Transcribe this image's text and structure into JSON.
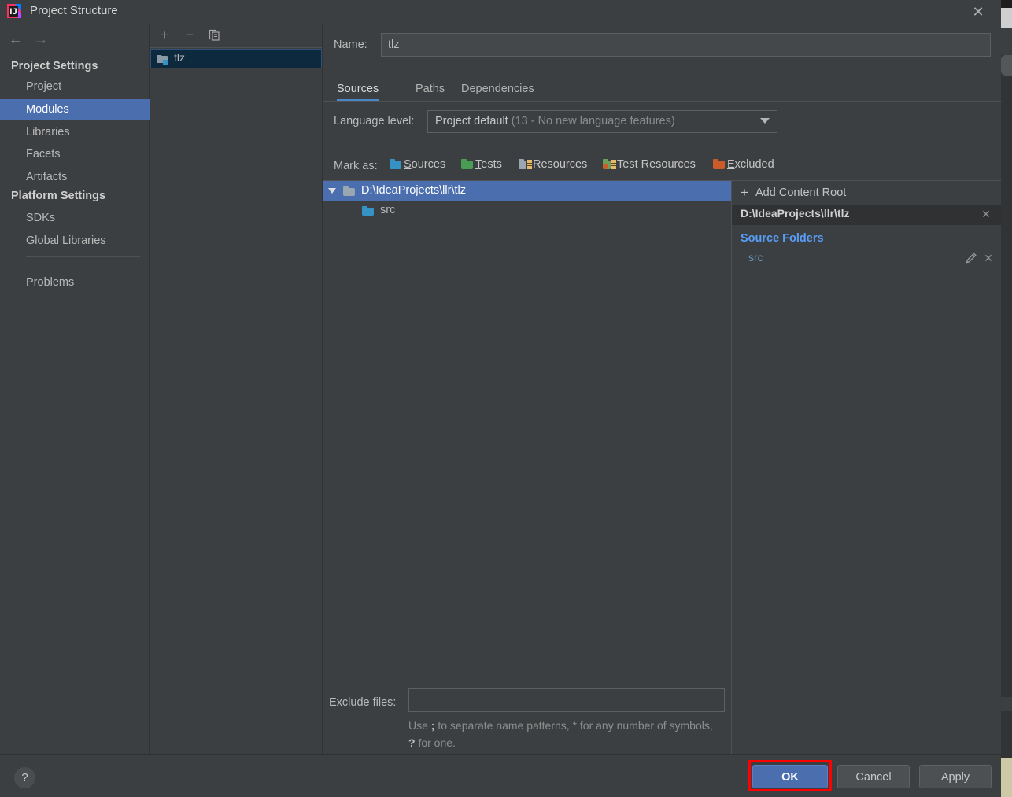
{
  "window": {
    "title": "Project Structure",
    "app_icon": "intellij-idea-logo",
    "close_icon": "✕"
  },
  "nav": {
    "back_icon": "←",
    "forward_icon": "→"
  },
  "sidebar": {
    "groups": [
      {
        "label": "Project Settings"
      },
      {
        "label": "Platform Settings"
      }
    ],
    "items": [
      {
        "label": "Project",
        "selected": false
      },
      {
        "label": "Modules",
        "selected": true
      },
      {
        "label": "Libraries",
        "selected": false
      },
      {
        "label": "Facets",
        "selected": false
      },
      {
        "label": "Artifacts",
        "selected": false
      },
      {
        "label": "SDKs",
        "selected": false
      },
      {
        "label": "Global Libraries",
        "selected": false
      },
      {
        "label": "Problems",
        "selected": false
      }
    ]
  },
  "modules_panel": {
    "toolbar": {
      "add_icon": "+",
      "remove_icon": "−",
      "copy_icon": "copy-icon"
    },
    "modules": [
      {
        "name": "tlz",
        "icon": "module-folder-icon",
        "selected": true
      }
    ]
  },
  "main": {
    "name_label": "Name:",
    "name_value": "tlz",
    "tabs": [
      {
        "label": "Sources",
        "active": true
      },
      {
        "label": "Paths",
        "active": false
      },
      {
        "label": "Dependencies",
        "active": false
      }
    ],
    "language_level": {
      "label": "Language level:",
      "value": "Project default",
      "value_suffix": " (13 - No new language features)",
      "arrow_icon": "chevron-down-icon"
    },
    "mark_as": {
      "label": "Mark as:",
      "options": [
        {
          "label": "Sources",
          "mnemonic": "S",
          "color": "#3592c4"
        },
        {
          "label": "Tests",
          "mnemonic": "T",
          "color": "#499c54"
        },
        {
          "label": "Resources",
          "mnemonic": "R",
          "color": "#9aa7b0"
        },
        {
          "label": "Test Resources",
          "mnemonic": "T",
          "color": "#6e9f5a"
        },
        {
          "label": "Excluded",
          "mnemonic": "E",
          "color": "#cc5b28"
        }
      ]
    },
    "content_tree": {
      "root": {
        "label": "D:\\IdeaProjects\\llr\\tlz",
        "icon": "folder-icon",
        "expanded": true,
        "selected": true
      },
      "children": [
        {
          "label": "src",
          "icon": "source-folder-icon",
          "color": "#3592c4"
        }
      ]
    },
    "root_panel": {
      "add_content_root": {
        "label": "Add Content Root",
        "mnemonic": "C",
        "plus_icon": "+"
      },
      "content_root_path": "D:\\IdeaProjects\\llr\\tlz",
      "content_root_close_icon": "✕",
      "source_folders_title": "Source Folders",
      "source_folders": [
        {
          "name": "src",
          "edit_icon": "pencil-icon",
          "remove_icon": "✕"
        }
      ]
    },
    "exclude": {
      "label": "Exclude files:",
      "value": "",
      "placeholder": "",
      "hint_prefix": "Use ",
      "hint_semicolon": ";",
      "hint_mid": " to separate name patterns, * for any number of symbols, ",
      "hint_question": "?",
      "hint_suffix": " for one.",
      "hint_full": "Use ; to separate name patterns, * for any number of symbols, ? for one."
    }
  },
  "footer": {
    "help_icon": "?",
    "ok_label": "OK",
    "cancel_label": "Cancel",
    "apply_label": "Apply",
    "ok_highlight_color": "#fe0000"
  },
  "theme": {
    "dialog_bg": "#3c3f41",
    "selection_blue": "#4b6eaf",
    "accent_blue": "#589df6",
    "tab_underline": "#4a88c7",
    "module_selected_bg": "#0d293e"
  }
}
